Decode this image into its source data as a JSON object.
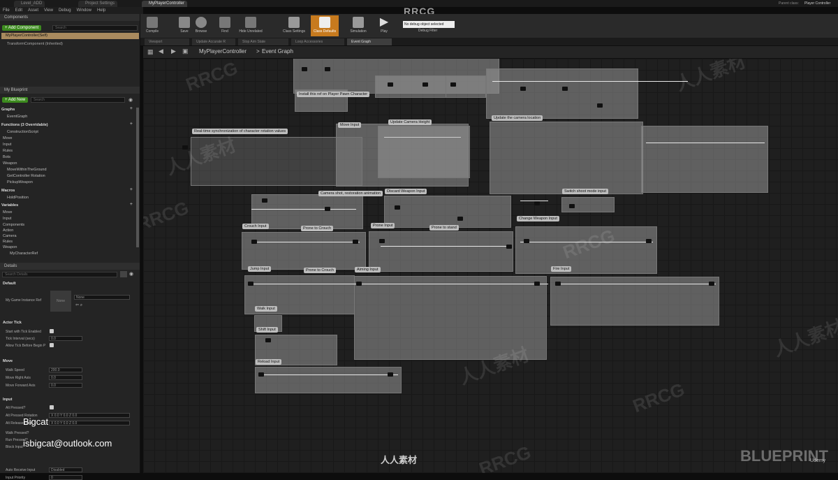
{
  "title_bar": {
    "tabs": [
      "Level_ADD",
      "Project Settings",
      "MyPlayerController"
    ],
    "brand": "RRCG",
    "parent_class_label": "Parent class:",
    "parent_class_value": "Player Controller"
  },
  "menu": [
    "File",
    "Edit",
    "Asset",
    "View",
    "Debug",
    "Window",
    "Help"
  ],
  "components": {
    "header": "Components",
    "add_button": "+ Add Component",
    "search_placeholder": "Search",
    "items": [
      "MyPlayerController(Self)",
      "TransformComponent (Inherited)"
    ]
  },
  "my_blueprint": {
    "header": "My Blueprint",
    "add_new": "+ Add New",
    "search_placeholder": "Search",
    "sections": [
      {
        "label": "Graphs",
        "items": [
          "EventGraph"
        ]
      },
      {
        "label": "Functions (3 Overridable)",
        "items": [
          "ConstructionScript",
          "Move",
          "Input",
          "Rules",
          "Bots",
          "Weapon",
          "MoveWithinTheGround",
          "GetController Rotation",
          "PickupWeapon"
        ]
      },
      {
        "label": "Macros",
        "items": [
          "HoldPosition"
        ]
      },
      {
        "label": "Variables",
        "items": [
          "Move",
          "Input",
          "Components",
          "Action",
          "Camera",
          "Rules",
          "Weapon",
          "MyCharacterRef"
        ]
      }
    ]
  },
  "details": {
    "header": "Details",
    "search_placeholder": "Search Details",
    "default_section": "Default",
    "my_game_instance_label": "My Game Instance Ref",
    "my_game_instance_value": "None",
    "none_thumb": "None",
    "actor_tick": "Actor Tick",
    "actor_tick_rows": [
      {
        "label": "Start with Tick Enabled",
        "value": ""
      },
      {
        "label": "Tick Interval (secs)",
        "value": "0.0"
      },
      {
        "label": "Allow Tick Before Begin P",
        "value": ""
      }
    ],
    "move_section": "Move",
    "move_rows": [
      {
        "label": "Walk Speed",
        "value": "200.0"
      },
      {
        "label": "Move Right Axis",
        "value": "0.0"
      },
      {
        "label": "Move Forward Axis",
        "value": "0.0"
      }
    ],
    "input_section": "Input",
    "input_rows": [
      {
        "label": "Alt Pressed?",
        "value": ""
      },
      {
        "label": "Alt Pressed Rotation",
        "value": "X 0.0   Y 0.0   Z 0.0"
      },
      {
        "label": "Alt Released Rot",
        "value": "X 0.0   Y 0.0   Z 0.0"
      },
      {
        "label": "Walk Pressed?",
        "value": ""
      },
      {
        "label": "Run Pressed?",
        "value": ""
      },
      {
        "label": "Block Input",
        "value": ""
      },
      {
        "label": "Auto Receive Input",
        "value": "Disabled"
      },
      {
        "label": "Input Priority",
        "value": "0"
      }
    ]
  },
  "toolbar": {
    "buttons": [
      "Compile",
      "Save",
      "Browse",
      "Find",
      "Hide Unrelated",
      "Class Settings",
      "Class Defaults",
      "Simulation",
      "Play"
    ],
    "debug_select": "No debug object selected",
    "debug_filter": "Debug Filter"
  },
  "doc_tabs": [
    "Viewport",
    "Update Accurate R",
    "Stop Aim State",
    "Loop Accessories",
    "Event Graph"
  ],
  "breadcrumb": {
    "root": "MyPlayerController",
    "separator": ">",
    "current": "Event Graph"
  },
  "comments": [
    "Install this ref on Player Pawn Character",
    "Move Input",
    "Update Camera Height",
    "Update the camera location",
    "Real-time synchronization of character rotation values",
    "Discard Weapon Input",
    "Camera shot, restoration animation",
    "Switch shoot mode input",
    "Crouch Input",
    "Prone to Crouch",
    "Prone Input",
    "Prone to stand",
    "Change Weapon Input",
    "Jump Input",
    "Prone to Crouch",
    "Aiming Input",
    "Fire Input",
    "Walk Input",
    "Shift Input",
    "Reload Input"
  ],
  "watermarks": {
    "rrcg": "RRCG",
    "rrsc": "人人素材",
    "bigcat": "Bigcat",
    "email": "isbigcat@outlook.com",
    "blueprint": "BLUEPRINT",
    "udemy": "Udemy",
    "renren_footer": "人人素材"
  }
}
